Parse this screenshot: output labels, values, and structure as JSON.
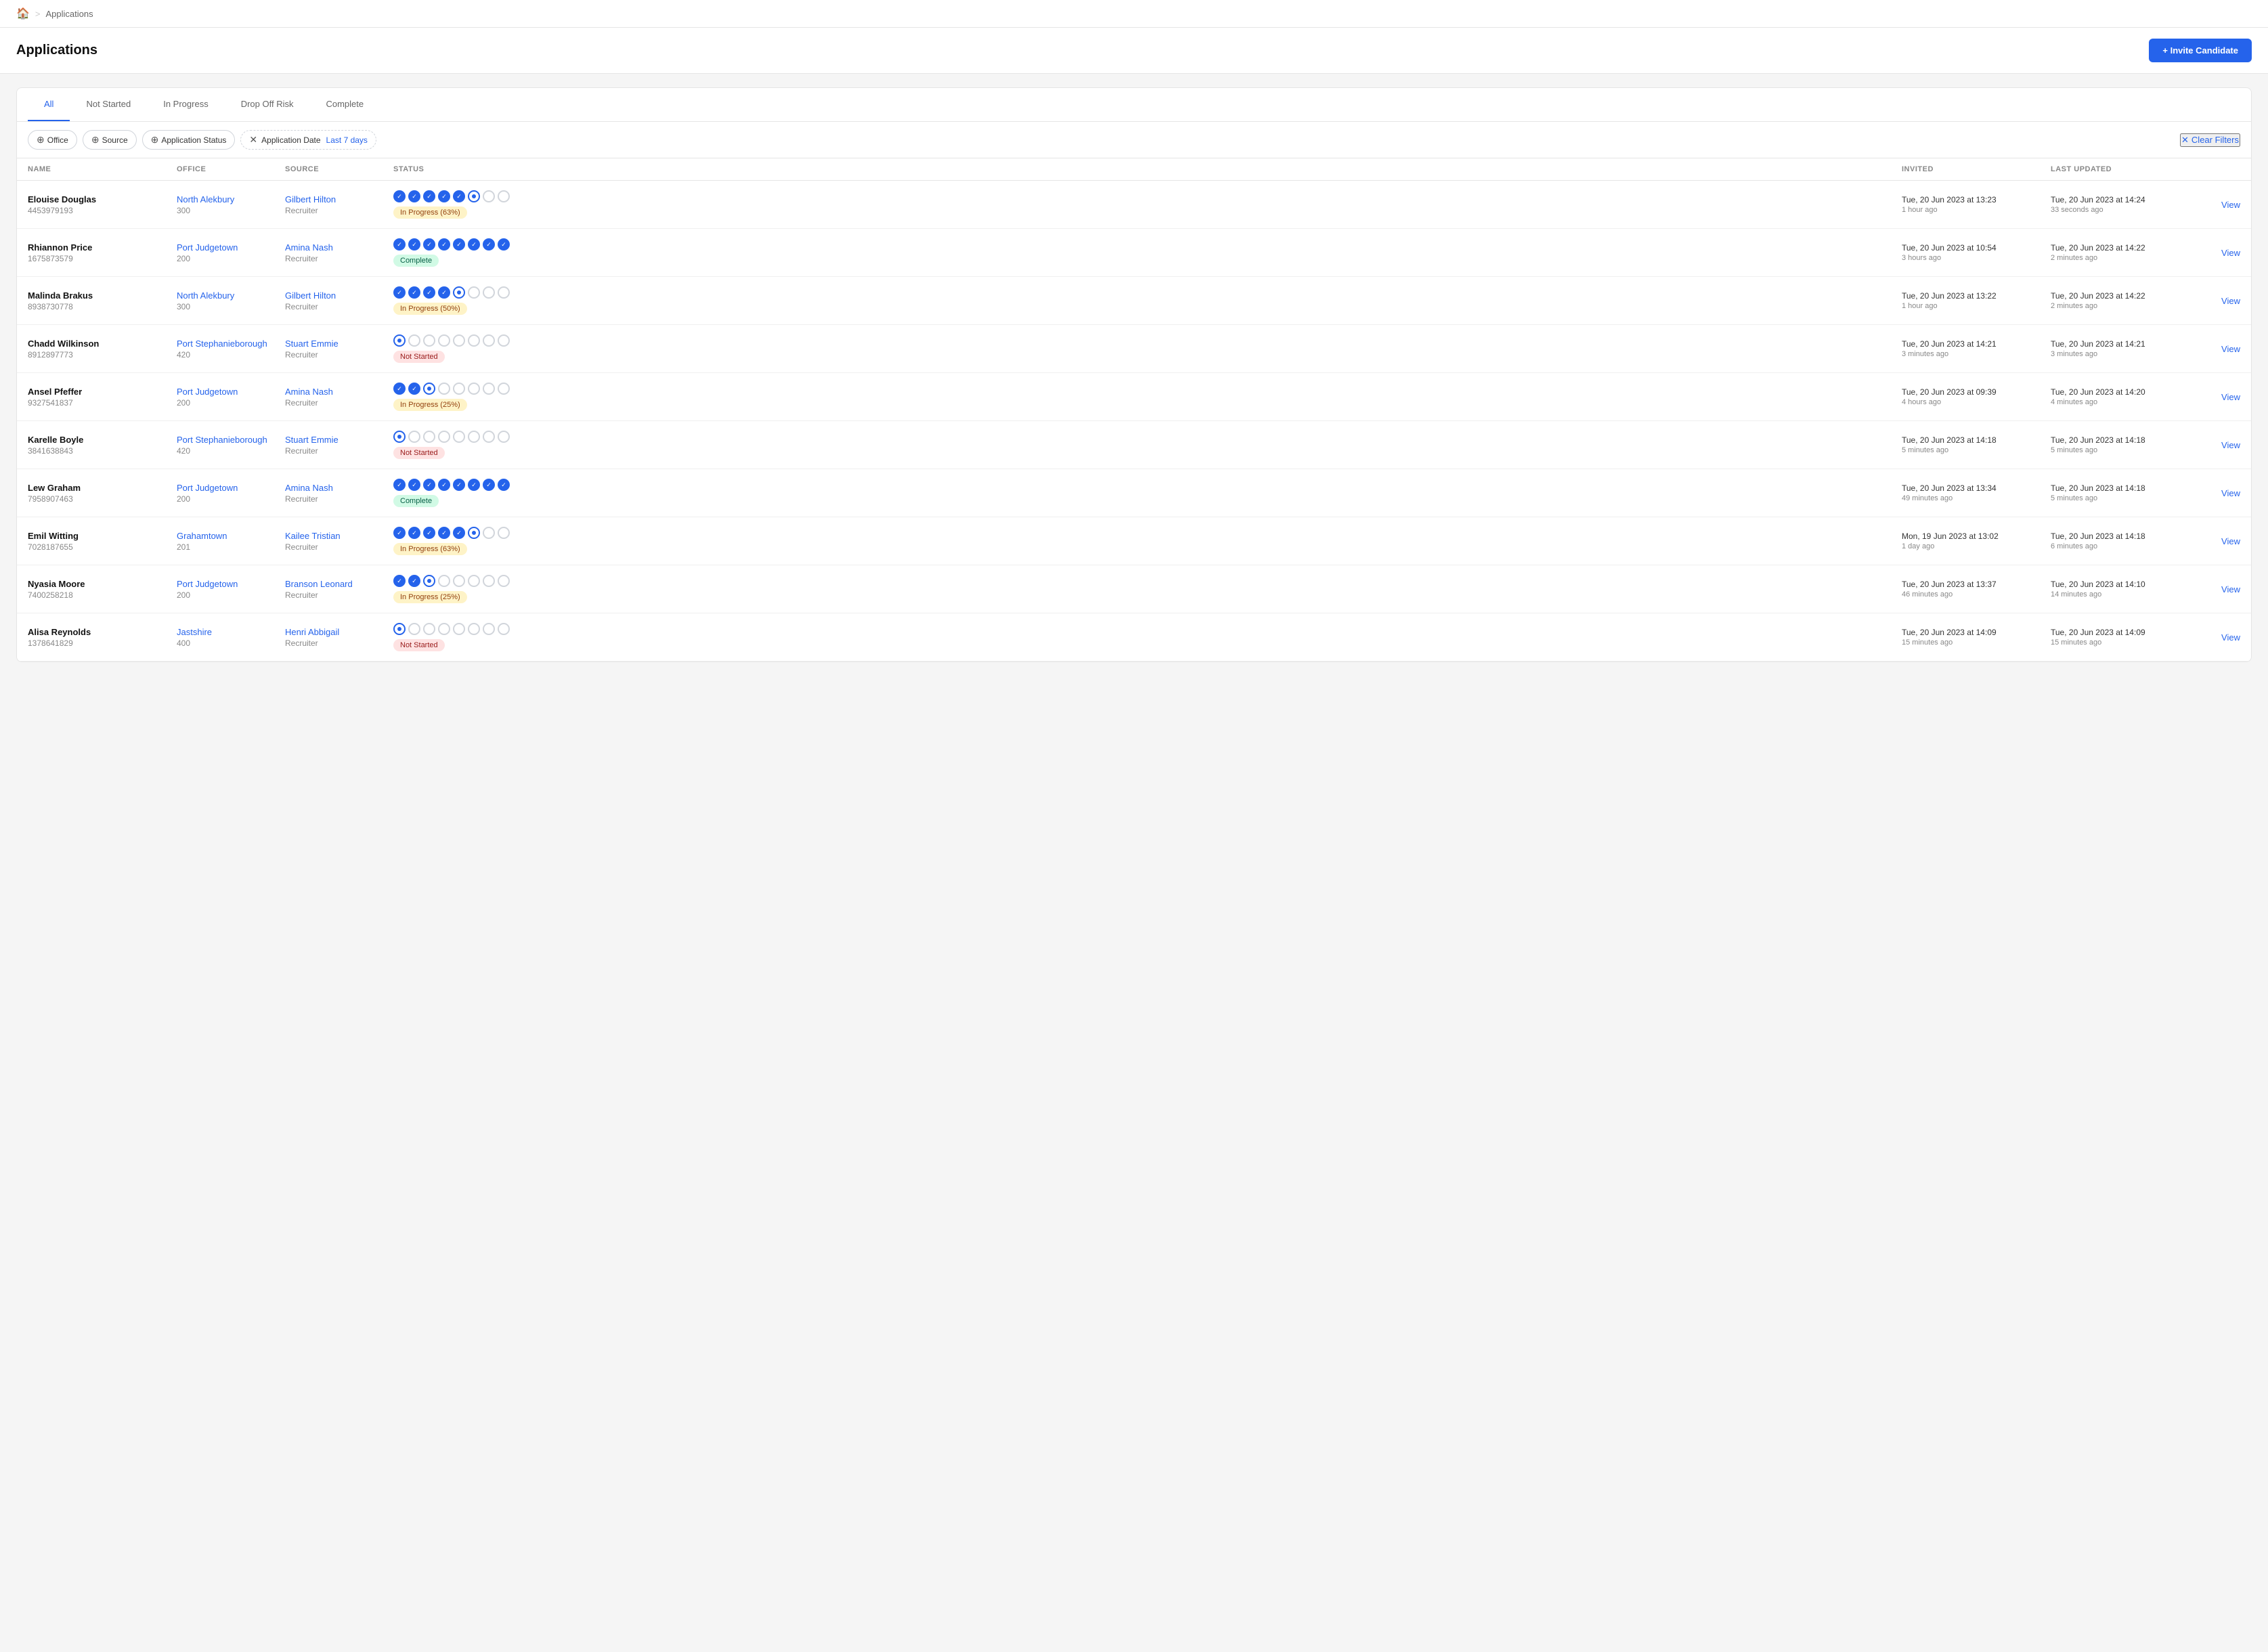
{
  "breadcrumb": {
    "home_icon": "🏠",
    "separator": ">",
    "current": "Applications"
  },
  "header": {
    "title": "Applications",
    "invite_button": "+ Invite Candidate"
  },
  "tabs": [
    {
      "label": "All",
      "active": true
    },
    {
      "label": "Not Started",
      "active": false
    },
    {
      "label": "In Progress",
      "active": false
    },
    {
      "label": "Drop Off Risk",
      "active": false
    },
    {
      "label": "Complete",
      "active": false
    }
  ],
  "filters": {
    "office_label": "Office",
    "source_label": "Source",
    "app_status_label": "Application Status",
    "app_date_label": "Application Date",
    "date_value": "Last 7 days",
    "clear_label": "Clear Filters"
  },
  "table_headers": {
    "name": "NAME",
    "office": "OFFICE",
    "source": "SOURCE",
    "status": "STATUS",
    "invited": "INVITED",
    "last_updated": "LAST UPDATED",
    "action": ""
  },
  "rows": [
    {
      "name": "Elouise Douglas",
      "phone": "4453979193",
      "office": "North Alekbury",
      "office_num": "300",
      "source": "Gilbert Hilton",
      "source_role": "Recruiter",
      "circles": [
        1,
        1,
        1,
        1,
        1,
        0,
        0,
        0
      ],
      "current_idx": 5,
      "badge_type": "inprogress",
      "badge_text": "In Progress (63%)",
      "invited_date": "Tue, 20 Jun 2023 at 13:23",
      "invited_rel": "1 hour ago",
      "updated_date": "Tue, 20 Jun 2023 at 14:24",
      "updated_rel": "33 seconds ago",
      "view": "View"
    },
    {
      "name": "Rhiannon Price",
      "phone": "1675873579",
      "office": "Port Judgetown",
      "office_num": "200",
      "source": "Amina Nash",
      "source_role": "Recruiter",
      "circles": [
        1,
        1,
        1,
        1,
        1,
        1,
        1,
        1
      ],
      "current_idx": -1,
      "badge_type": "complete",
      "badge_text": "Complete",
      "invited_date": "Tue, 20 Jun 2023 at 10:54",
      "invited_rel": "3 hours ago",
      "updated_date": "Tue, 20 Jun 2023 at 14:22",
      "updated_rel": "2 minutes ago",
      "view": "View"
    },
    {
      "name": "Malinda Brakus",
      "phone": "8938730778",
      "office": "North Alekbury",
      "office_num": "300",
      "source": "Gilbert Hilton",
      "source_role": "Recruiter",
      "circles": [
        1,
        1,
        1,
        1,
        0,
        0,
        0,
        0
      ],
      "current_idx": 4,
      "badge_type": "inprogress",
      "badge_text": "In Progress (50%)",
      "invited_date": "Tue, 20 Jun 2023 at 13:22",
      "invited_rel": "1 hour ago",
      "updated_date": "Tue, 20 Jun 2023 at 14:22",
      "updated_rel": "2 minutes ago",
      "view": "View"
    },
    {
      "name": "Chadd Wilkinson",
      "phone": "8912897773",
      "office": "Port Stephanieborough",
      "office_num": "420",
      "source": "Stuart Emmie",
      "source_role": "Recruiter",
      "circles": [
        0,
        0,
        0,
        0,
        0,
        0,
        0,
        0
      ],
      "current_idx": 0,
      "badge_type": "notstarted",
      "badge_text": "Not Started",
      "invited_date": "Tue, 20 Jun 2023 at 14:21",
      "invited_rel": "3 minutes ago",
      "updated_date": "Tue, 20 Jun 2023 at 14:21",
      "updated_rel": "3 minutes ago",
      "view": "View"
    },
    {
      "name": "Ansel Pfeffer",
      "phone": "9327541837",
      "office": "Port Judgetown",
      "office_num": "200",
      "source": "Amina Nash",
      "source_role": "Recruiter",
      "circles": [
        1,
        1,
        0,
        0,
        0,
        0,
        0,
        0
      ],
      "current_idx": 2,
      "badge_type": "inprogress",
      "badge_text": "In Progress (25%)",
      "invited_date": "Tue, 20 Jun 2023 at 09:39",
      "invited_rel": "4 hours ago",
      "updated_date": "Tue, 20 Jun 2023 at 14:20",
      "updated_rel": "4 minutes ago",
      "view": "View"
    },
    {
      "name": "Karelle Boyle",
      "phone": "3841638843",
      "office": "Port Stephanieborough",
      "office_num": "420",
      "source": "Stuart Emmie",
      "source_role": "Recruiter",
      "circles": [
        0,
        0,
        0,
        0,
        0,
        0,
        0,
        0
      ],
      "current_idx": 0,
      "badge_type": "notstarted",
      "badge_text": "Not Started",
      "invited_date": "Tue, 20 Jun 2023 at 14:18",
      "invited_rel": "5 minutes ago",
      "updated_date": "Tue, 20 Jun 2023 at 14:18",
      "updated_rel": "5 minutes ago",
      "view": "View"
    },
    {
      "name": "Lew Graham",
      "phone": "7958907463",
      "office": "Port Judgetown",
      "office_num": "200",
      "source": "Amina Nash",
      "source_role": "Recruiter",
      "circles": [
        1,
        1,
        1,
        1,
        1,
        1,
        1,
        1
      ],
      "current_idx": -1,
      "badge_type": "complete",
      "badge_text": "Complete",
      "invited_date": "Tue, 20 Jun 2023 at 13:34",
      "invited_rel": "49 minutes ago",
      "updated_date": "Tue, 20 Jun 2023 at 14:18",
      "updated_rel": "5 minutes ago",
      "view": "View"
    },
    {
      "name": "Emil Witting",
      "phone": "7028187655",
      "office": "Grahamtown",
      "office_num": "201",
      "source": "Kailee Tristian",
      "source_role": "Recruiter",
      "circles": [
        1,
        1,
        1,
        1,
        1,
        0,
        0,
        0
      ],
      "current_idx": 5,
      "badge_type": "inprogress",
      "badge_text": "In Progress (63%)",
      "invited_date": "Mon, 19 Jun 2023 at 13:02",
      "invited_rel": "1 day ago",
      "updated_date": "Tue, 20 Jun 2023 at 14:18",
      "updated_rel": "6 minutes ago",
      "view": "View"
    },
    {
      "name": "Nyasia Moore",
      "phone": "7400258218",
      "office": "Port Judgetown",
      "office_num": "200",
      "source": "Branson Leonard",
      "source_role": "Recruiter",
      "circles": [
        1,
        1,
        0,
        0,
        0,
        0,
        0,
        0
      ],
      "current_idx": 2,
      "badge_type": "inprogress",
      "badge_text": "In Progress (25%)",
      "invited_date": "Tue, 20 Jun 2023 at 13:37",
      "invited_rel": "46 minutes ago",
      "updated_date": "Tue, 20 Jun 2023 at 14:10",
      "updated_rel": "14 minutes ago",
      "view": "View"
    },
    {
      "name": "Alisa Reynolds",
      "phone": "1378641829",
      "office": "Jastshire",
      "office_num": "400",
      "source": "Henri Abbigail",
      "source_role": "Recruiter",
      "circles": [
        0,
        0,
        0,
        0,
        0,
        0,
        0,
        0
      ],
      "current_idx": 0,
      "badge_type": "notstarted",
      "badge_text": "Not Started",
      "invited_date": "Tue, 20 Jun 2023 at 14:09",
      "invited_rel": "15 minutes ago",
      "updated_date": "Tue, 20 Jun 2023 at 14:09",
      "updated_rel": "15 minutes ago",
      "view": "View"
    }
  ]
}
